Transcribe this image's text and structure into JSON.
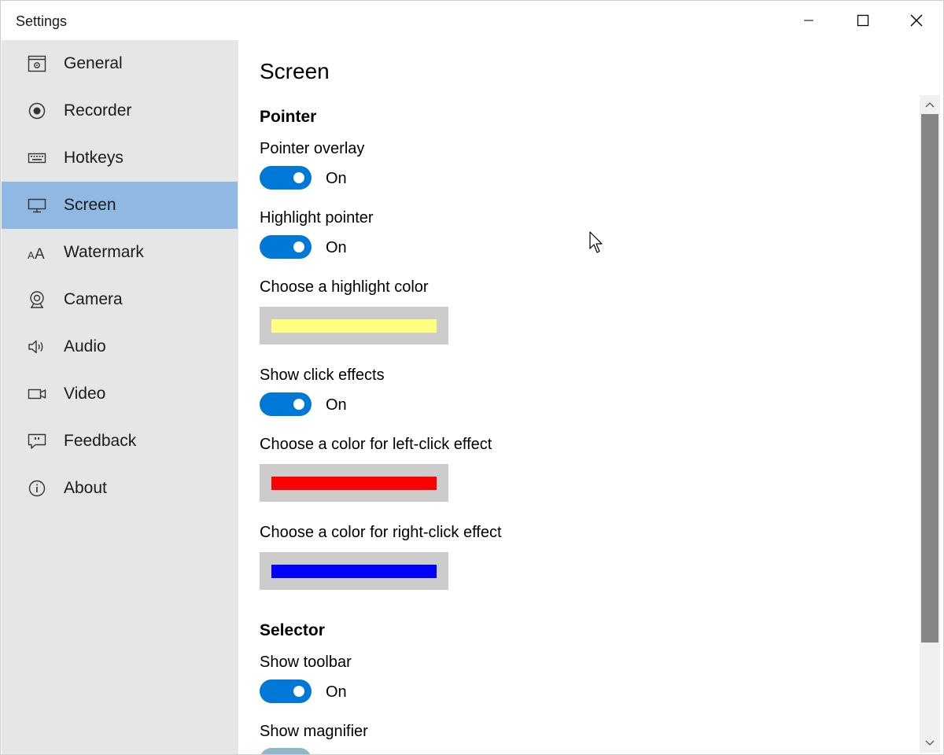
{
  "window": {
    "title": "Settings"
  },
  "sidebar": {
    "items": [
      {
        "label": "General",
        "icon": "general-icon"
      },
      {
        "label": "Recorder",
        "icon": "record-icon"
      },
      {
        "label": "Hotkeys",
        "icon": "keyboard-icon"
      },
      {
        "label": "Screen",
        "icon": "monitor-icon",
        "selected": true
      },
      {
        "label": "Watermark",
        "icon": "font-size-icon"
      },
      {
        "label": "Camera",
        "icon": "webcam-icon"
      },
      {
        "label": "Audio",
        "icon": "speaker-icon"
      },
      {
        "label": "Video",
        "icon": "video-camera-icon"
      },
      {
        "label": "Feedback",
        "icon": "feedback-icon"
      },
      {
        "label": "About",
        "icon": "info-icon"
      }
    ]
  },
  "main": {
    "page_title": "Screen",
    "pointer": {
      "section_title": "Pointer",
      "pointer_overlay": {
        "label": "Pointer overlay",
        "state": "On"
      },
      "highlight_pointer": {
        "label": "Highlight pointer",
        "state": "On"
      },
      "highlight_color": {
        "label": "Choose a highlight color",
        "color": "#ffff80"
      },
      "show_click_effects": {
        "label": "Show click effects",
        "state": "On"
      },
      "left_click_color": {
        "label": "Choose a color for left-click effect",
        "color": "#ff0000"
      },
      "right_click_color": {
        "label": "Choose a color for right-click effect",
        "color": "#0000ff"
      }
    },
    "selector": {
      "section_title": "Selector",
      "show_toolbar": {
        "label": "Show toolbar",
        "state": "On"
      },
      "show_magnifier": {
        "label": "Show magnifier"
      }
    }
  },
  "colors": {
    "accent": "#0078d7",
    "sidebar_bg": "#e6e6e6",
    "selected_bg": "#8fb8e2"
  }
}
